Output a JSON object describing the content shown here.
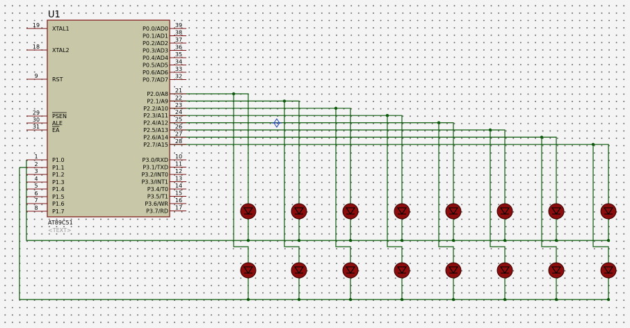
{
  "chip": {
    "ref": "U1",
    "part": "AT89C51",
    "text": "<TEXT>",
    "left_pins": [
      {
        "num": "19",
        "name": "XTAL1",
        "bar": false
      },
      {
        "num": "18",
        "name": "XTAL2",
        "bar": false
      },
      {
        "num": "9",
        "name": "RST",
        "bar": false
      },
      {
        "num": "29",
        "name": "PSEN",
        "bar": true
      },
      {
        "num": "30",
        "name": "ALE",
        "bar": false
      },
      {
        "num": "31",
        "name": "EA",
        "bar": true
      },
      {
        "num": "1",
        "name": "P1.0",
        "bar": false
      },
      {
        "num": "2",
        "name": "P1.1",
        "bar": false
      },
      {
        "num": "3",
        "name": "P1.2",
        "bar": false
      },
      {
        "num": "4",
        "name": "P1.3",
        "bar": false
      },
      {
        "num": "5",
        "name": "P1.4",
        "bar": false
      },
      {
        "num": "6",
        "name": "P1.5",
        "bar": false
      },
      {
        "num": "7",
        "name": "P1.6",
        "bar": false
      },
      {
        "num": "8",
        "name": "P1.7",
        "bar": false
      }
    ],
    "right_pins": [
      {
        "num": "39",
        "name": "P0.0/AD0"
      },
      {
        "num": "38",
        "name": "P0.1/AD1"
      },
      {
        "num": "37",
        "name": "P0.2/AD2"
      },
      {
        "num": "36",
        "name": "P0.3/AD3"
      },
      {
        "num": "35",
        "name": "P0.4/AD4"
      },
      {
        "num": "34",
        "name": "P0.5/AD5"
      },
      {
        "num": "33",
        "name": "P0.6/AD6"
      },
      {
        "num": "32",
        "name": "P0.7/AD7"
      },
      {
        "num": "21",
        "name": "P2.0/A8"
      },
      {
        "num": "22",
        "name": "P2.1/A9"
      },
      {
        "num": "23",
        "name": "P2.2/A10"
      },
      {
        "num": "24",
        "name": "P2.3/A11"
      },
      {
        "num": "25",
        "name": "P2.4/A12"
      },
      {
        "num": "26",
        "name": "P2.5/A13"
      },
      {
        "num": "27",
        "name": "P2.6/A14"
      },
      {
        "num": "28",
        "name": "P2.7/A15"
      },
      {
        "num": "10",
        "name": "P3.0/RXD"
      },
      {
        "num": "11",
        "name": "P3.1/TXD"
      },
      {
        "num": "12",
        "name": "P3.2/INT0"
      },
      {
        "num": "13",
        "name": "P3.3/INT1"
      },
      {
        "num": "14",
        "name": "P3.4/T0"
      },
      {
        "num": "15",
        "name": "P3.5/T1"
      },
      {
        "num": "16",
        "name": "P3.6/WR"
      },
      {
        "num": "17",
        "name": "P3.7/RD"
      }
    ]
  },
  "led_columns": 8,
  "led_rows": 2,
  "colors": {
    "wire": "#0a5a0a",
    "chip_body": "#c8c8a8",
    "pin": "#7a1010",
    "led": "#8a0c0c",
    "grid_dot": "#6a6a6a",
    "background": "#f4f4f4"
  }
}
